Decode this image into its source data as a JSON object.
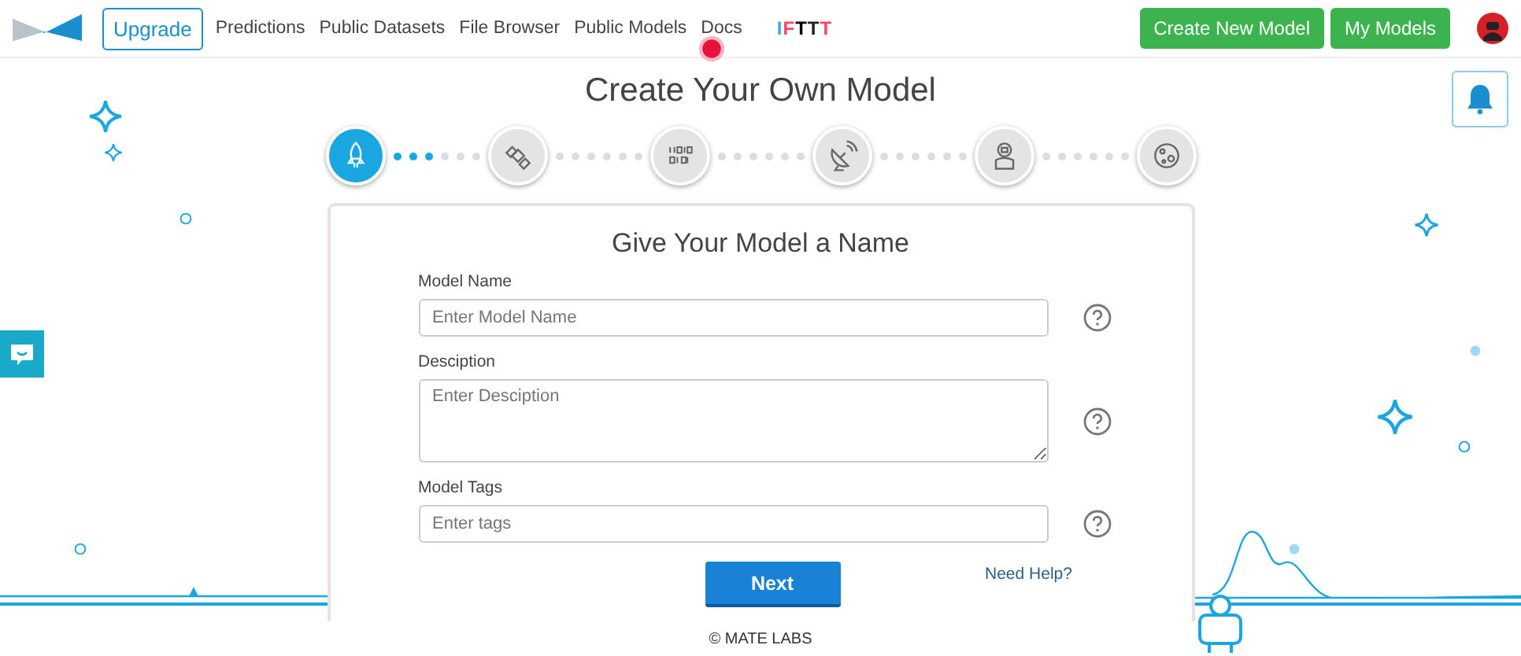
{
  "nav": {
    "upgrade": "Upgrade",
    "links": [
      "Predictions",
      "Public Datasets",
      "File Browser",
      "Public Models",
      "Docs"
    ],
    "ifttt": "IFTTT",
    "buttons": [
      "Create New Model",
      "My Models"
    ]
  },
  "title": "Create Your Own Model",
  "steps": [
    {
      "selected": true
    },
    {
      "selected": false
    },
    {
      "selected": false
    },
    {
      "selected": false
    },
    {
      "selected": false
    },
    {
      "selected": false
    }
  ],
  "form": {
    "heading": "Give Your Model a Name",
    "fields": [
      {
        "kind": "input",
        "label": "Model Name",
        "placeholder": "Enter Model Name"
      },
      {
        "kind": "textarea",
        "label": "Desciption",
        "placeholder": "Enter Desciption"
      },
      {
        "kind": "input",
        "label": "Model Tags",
        "placeholder": "Enter tags"
      }
    ],
    "next": "Next",
    "help": "Need Help?"
  },
  "footer": "© MATE LABS"
}
